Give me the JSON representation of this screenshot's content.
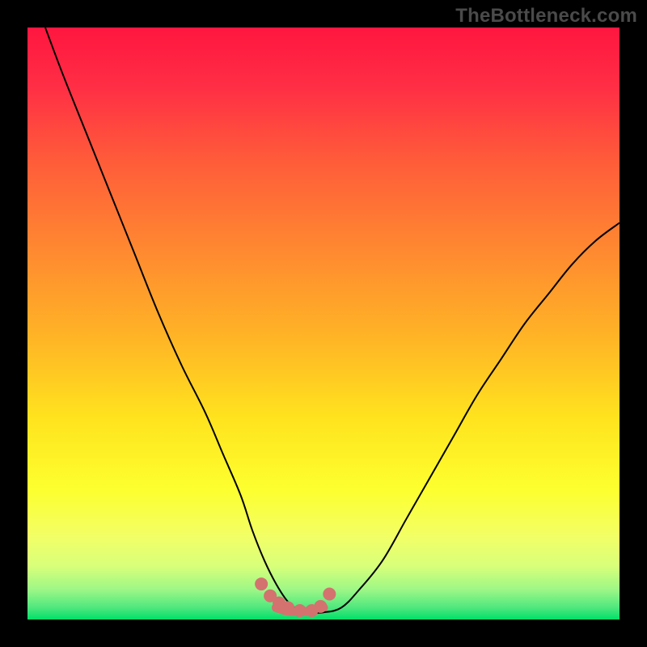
{
  "watermark": {
    "text": "TheBottleneck.com"
  },
  "chart_data": {
    "type": "line",
    "title": "",
    "xlabel": "",
    "ylabel": "",
    "xlim": [
      0,
      100
    ],
    "ylim": [
      0,
      100
    ],
    "grid": false,
    "legend": false,
    "background_gradient": {
      "top_color": "#ff1a47",
      "mid_colors": [
        "#ff5a3a",
        "#ffb030",
        "#fff22a",
        "#f6ff5a",
        "#c8ff78"
      ],
      "bottom_color": "#00e56a"
    },
    "series": [
      {
        "name": "bottleneck-curve",
        "type": "line",
        "stroke": "#000000",
        "stroke_width": 2,
        "x": [
          3,
          6,
          10,
          14,
          18,
          22,
          26,
          30,
          33,
          36,
          38,
          40,
          42,
          44,
          46,
          48,
          50,
          53,
          56,
          60,
          64,
          68,
          72,
          76,
          80,
          84,
          88,
          92,
          96,
          100
        ],
        "y": [
          100,
          92,
          82,
          72,
          62,
          52,
          43,
          35,
          28,
          21,
          15,
          10,
          6,
          3,
          1.5,
          1.2,
          1.2,
          2,
          5,
          10,
          17,
          24,
          31,
          38,
          44,
          50,
          55,
          60,
          64,
          67
        ]
      },
      {
        "name": "marker-dots",
        "type": "scatter",
        "color": "#d4726f",
        "radius": 8,
        "x": [
          39.5,
          41,
          42.5,
          44,
          46,
          48,
          49.5,
          51
        ],
        "y": [
          6,
          4,
          2.8,
          2,
          1.5,
          1.5,
          2.2,
          4.3
        ]
      },
      {
        "name": "valley-segment",
        "type": "line",
        "stroke": "#d4726f",
        "stroke_width": 11,
        "x": [
          42,
          44,
          46,
          48,
          50
        ],
        "y": [
          2.0,
          1.4,
          1.4,
          1.4,
          2.0
        ]
      }
    ]
  }
}
